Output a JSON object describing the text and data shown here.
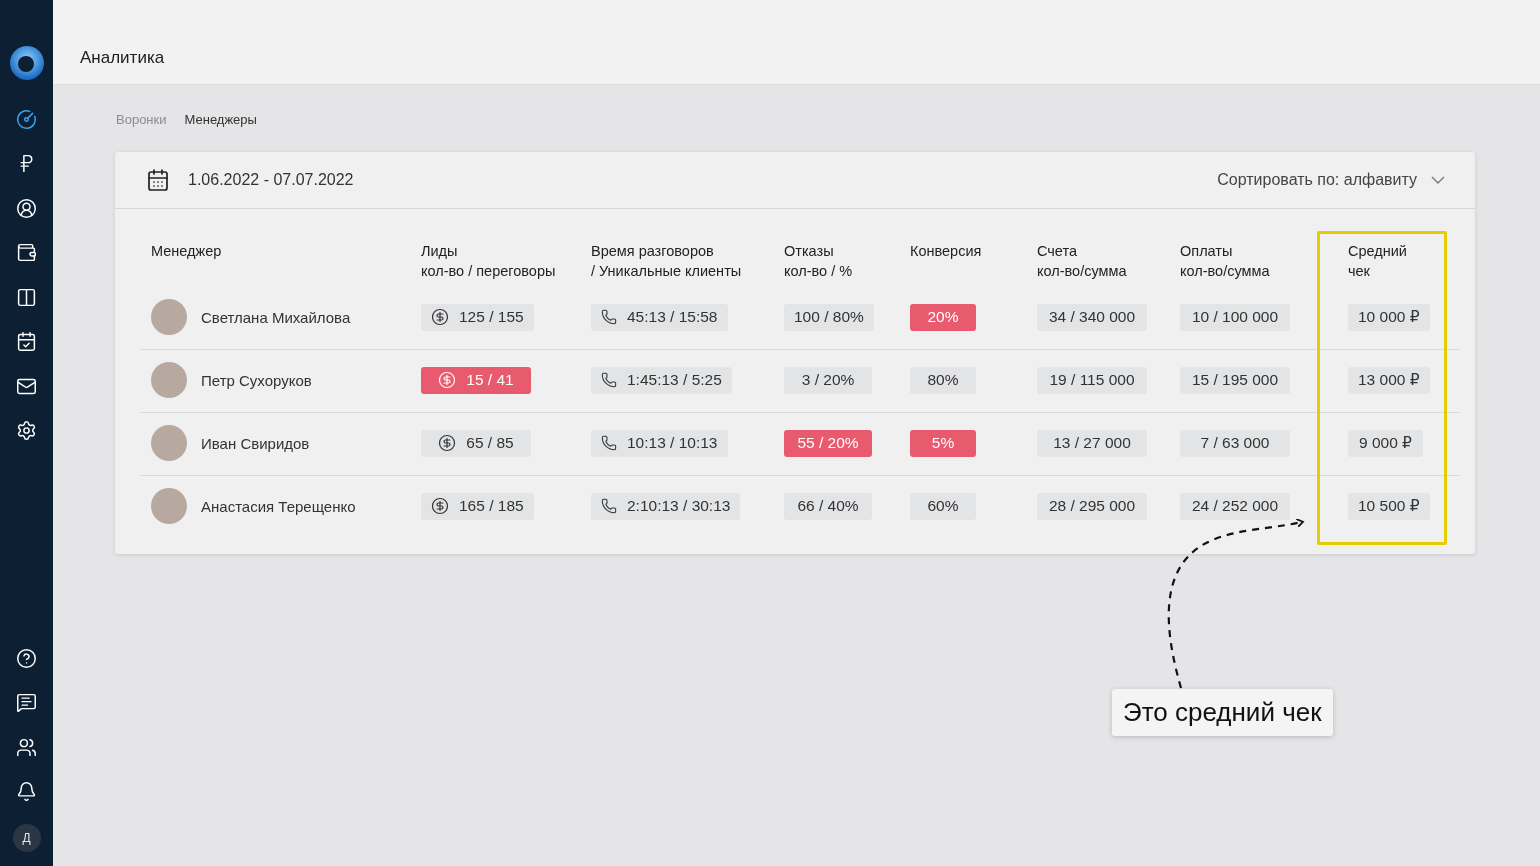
{
  "sidebar": {
    "items": [
      {
        "selected": true
      },
      {
        "selected": false
      },
      {
        "selected": false
      },
      {
        "selected": false
      },
      {
        "selected": false
      },
      {
        "selected": false
      },
      {
        "selected": false
      },
      {
        "selected": false
      }
    ],
    "bottom_items": [
      {
        "selected": false
      },
      {
        "selected": false
      },
      {
        "selected": false
      },
      {
        "selected": false
      }
    ],
    "user_initial": "Д"
  },
  "header": {
    "title": "Аналитика"
  },
  "tabs": [
    {
      "label": "Воронки",
      "selected": false
    },
    {
      "label": "Менеджеры",
      "selected": true
    }
  ],
  "card": {
    "date_range": "1.06.2022 - 07.07.2022",
    "sort": "Сортировать по: алфавиту",
    "columns": [
      {
        "label": "Менеджер",
        "highlighted": false
      },
      {
        "label": "Лиды\nкол-во / переговоры",
        "highlighted": false
      },
      {
        "label": "Время разговоров\n/ Уникальные клиенты",
        "highlighted": false
      },
      {
        "label": "Отказы\nкол-во / %",
        "highlighted": false
      },
      {
        "label": "Конверсия",
        "highlighted": false
      },
      {
        "label": "Счета\nкол-во/сумма",
        "highlighted": false
      },
      {
        "label": "Оплаты\nкол-во/сумма",
        "highlighted": false
      },
      {
        "label": "Средний\nчек",
        "highlighted": true
      }
    ],
    "rows": [
      {
        "cells": [
          {
            "kind": "manager",
            "text": "Светлана Михайлова",
            "alert": false
          },
          {
            "kind": "leads",
            "text": "125 / 155",
            "alert": false
          },
          {
            "kind": "time",
            "text": "45:13 / 15:58",
            "alert": false
          },
          {
            "kind": "plain",
            "text": "100 / 80%",
            "alert": false
          },
          {
            "kind": "plain",
            "text": "20%",
            "alert": true
          },
          {
            "kind": "plain",
            "text": "34 / 340 000",
            "alert": false
          },
          {
            "kind": "plain",
            "text": "10 / 100 000",
            "alert": false
          },
          {
            "kind": "plain",
            "text": "10 000 ₽",
            "alert": false
          }
        ]
      },
      {
        "cells": [
          {
            "kind": "manager",
            "text": "Петр Сухоруков",
            "alert": false
          },
          {
            "kind": "leads",
            "text": "15 / 41",
            "alert": true
          },
          {
            "kind": "time",
            "text": "1:45:13 / 5:25",
            "alert": false
          },
          {
            "kind": "plain",
            "text": "3 / 20%",
            "alert": false
          },
          {
            "kind": "plain",
            "text": "80%",
            "alert": false
          },
          {
            "kind": "plain",
            "text": "19 / 115 000",
            "alert": false
          },
          {
            "kind": "plain",
            "text": "15 / 195 000",
            "alert": false
          },
          {
            "kind": "plain",
            "text": "13 000 ₽",
            "alert": false
          }
        ]
      },
      {
        "cells": [
          {
            "kind": "manager",
            "text": "Иван Свиридов",
            "alert": false
          },
          {
            "kind": "leads",
            "text": "65 / 85",
            "alert": false
          },
          {
            "kind": "time",
            "text": "10:13 / 10:13",
            "alert": false
          },
          {
            "kind": "plain",
            "text": "55 / 20%",
            "alert": true
          },
          {
            "kind": "plain",
            "text": "5%",
            "alert": true
          },
          {
            "kind": "plain",
            "text": "13 / 27 000",
            "alert": false
          },
          {
            "kind": "plain",
            "text": "7 / 63 000",
            "alert": false
          },
          {
            "kind": "plain",
            "text": "9 000 ₽",
            "alert": false
          }
        ]
      },
      {
        "cells": [
          {
            "kind": "manager",
            "text": "Анастасия Терещенко",
            "alert": false
          },
          {
            "kind": "leads",
            "text": "165 / 185",
            "alert": false
          },
          {
            "kind": "time",
            "text": "2:10:13 / 30:13",
            "alert": false
          },
          {
            "kind": "plain",
            "text": "66 / 40%",
            "alert": false
          },
          {
            "kind": "plain",
            "text": "60%",
            "alert": false
          },
          {
            "kind": "plain",
            "text": "28 / 295 000",
            "alert": false
          },
          {
            "kind": "plain",
            "text": "24 / 252 000",
            "alert": false
          },
          {
            "kind": "plain",
            "text": "10 500 ₽",
            "alert": false
          }
        ]
      }
    ]
  },
  "annotation": {
    "text": "Это средний чек"
  }
}
